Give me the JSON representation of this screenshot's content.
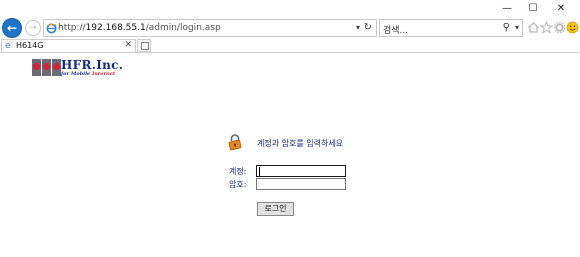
{
  "window": {
    "minimize_glyph": "—",
    "maximize_glyph": "☐",
    "close_glyph": "✕"
  },
  "browser": {
    "back_glyph": "←",
    "forward_glyph": "→",
    "address": {
      "prefix": "http://",
      "host": "192.168.55.1",
      "path": "/admin/login.asp",
      "dropdown_glyph": "▾",
      "refresh_glyph": "↻"
    },
    "search": {
      "placeholder": "검색...",
      "search_glyph": "⚲",
      "dropdown_glyph": "▾"
    },
    "toolbar_icons": [
      "home-icon",
      "favorites-star-icon",
      "settings-gear-icon",
      "feedback-smiley-icon"
    ],
    "tab": {
      "label": "H614G",
      "close_glyph": "✕"
    }
  },
  "page": {
    "logo": {
      "brand": "HFR.Inc.",
      "tagline_prefix": "for Mobile ",
      "tagline_highlight": "Internet"
    },
    "login": {
      "prompt": "계정과 암호를 입력하세요",
      "account_label": "계정:",
      "password_label": "암호:",
      "account_value": "",
      "password_value": "",
      "button_label": "로그인"
    }
  },
  "colors": {
    "accent_blue": "#1c75c8",
    "brand_navy": "#1a2b88",
    "brand_red": "#d6223a",
    "lock_orange": "#e8891f"
  }
}
